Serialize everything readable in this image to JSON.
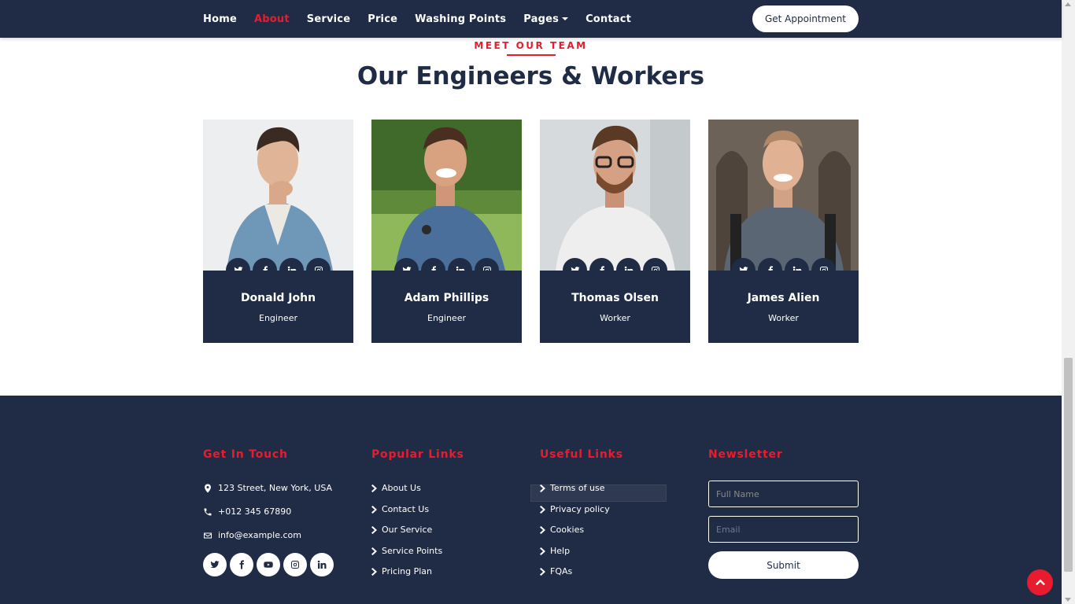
{
  "nav": {
    "items": [
      {
        "label": "Home",
        "active": false
      },
      {
        "label": "About",
        "active": true
      },
      {
        "label": "Service",
        "active": false
      },
      {
        "label": "Price",
        "active": false
      },
      {
        "label": "Washing Points",
        "active": false
      },
      {
        "label": "Pages",
        "active": false
      },
      {
        "label": "Contact",
        "active": false
      }
    ],
    "cta_label": "Get Appointment"
  },
  "team_section": {
    "subtitle": "MEET OUR TEAM",
    "title": "Our Engineers & Workers",
    "members": [
      {
        "name": "Donald John",
        "role": "Engineer"
      },
      {
        "name": "Adam Phillips",
        "role": "Engineer"
      },
      {
        "name": "Thomas Olsen",
        "role": "Worker"
      },
      {
        "name": "James Alien",
        "role": "Worker"
      }
    ],
    "social_icons": [
      "twitter-icon",
      "facebook-icon",
      "linkedin-icon",
      "instagram-icon"
    ]
  },
  "footer": {
    "get_in_touch": {
      "title": "Get In Touch",
      "address": "123 Street, New York, USA",
      "phone": "+012 345 67890",
      "email": "info@example.com",
      "social_icons": [
        "twitter-icon",
        "facebook-icon",
        "youtube-icon",
        "instagram-icon",
        "linkedin-icon"
      ]
    },
    "popular_links": {
      "title": "Popular Links",
      "items": [
        "About Us",
        "Contact Us",
        "Our Service",
        "Service Points",
        "Pricing Plan"
      ]
    },
    "useful_links": {
      "title": "Useful Links",
      "items": [
        "Terms of use",
        "Privacy policy",
        "Cookies",
        "Help",
        "FQAs"
      ]
    },
    "newsletter": {
      "title": "Newsletter",
      "name_value": "Full Name",
      "email_placeholder": "Email",
      "submit_label": "Submit"
    }
  },
  "colors": {
    "primary": "#202C45",
    "accent": "#E81C2E"
  }
}
